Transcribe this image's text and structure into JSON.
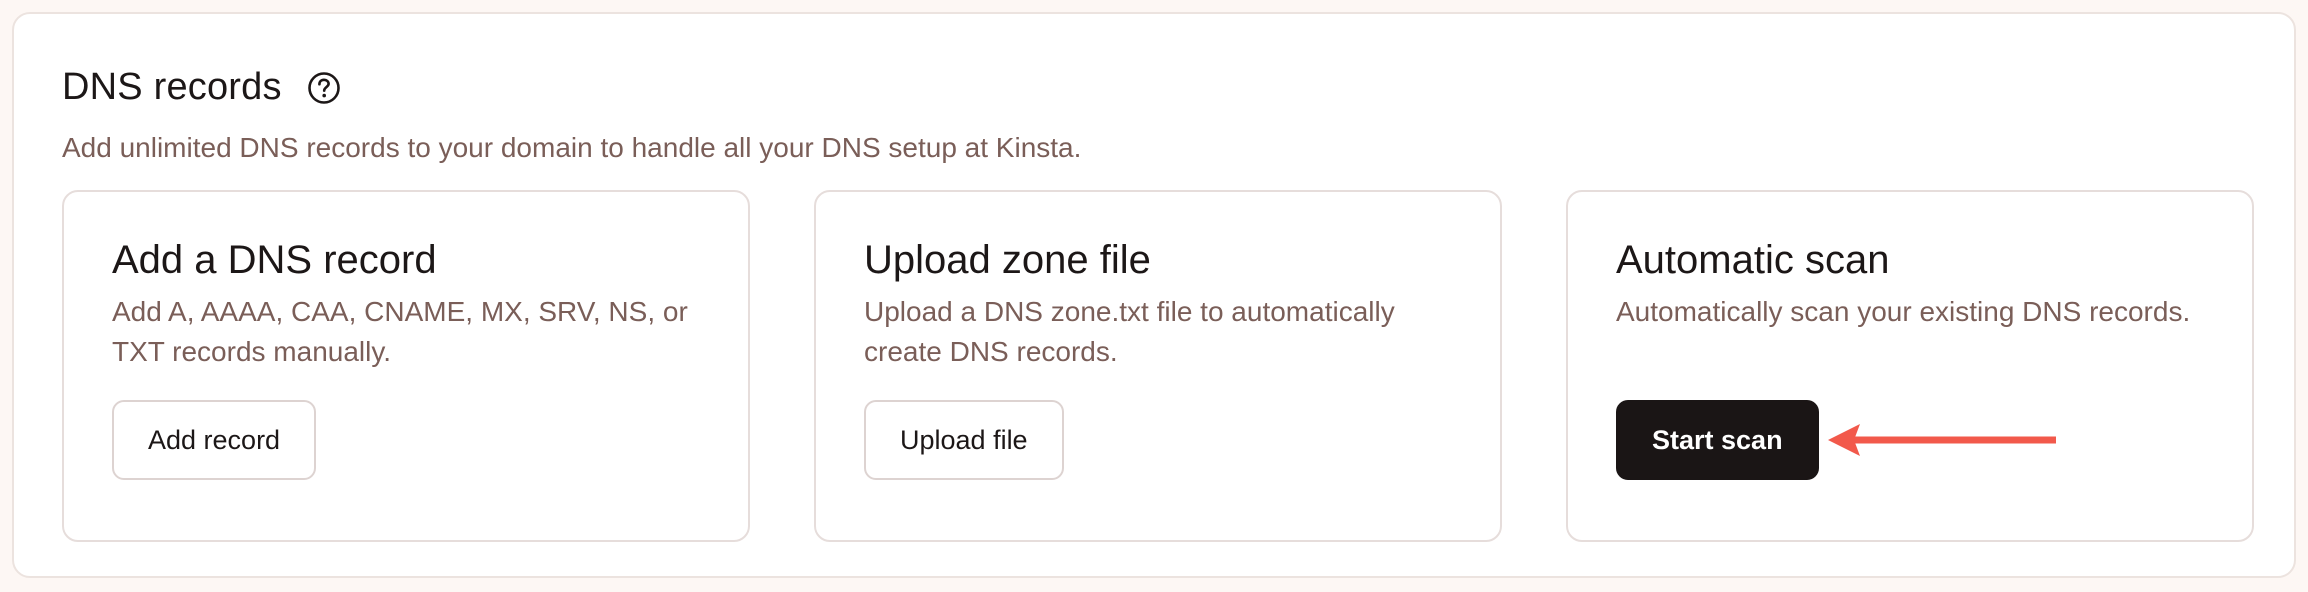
{
  "section": {
    "title": "DNS records",
    "subtitle": "Add unlimited DNS records to your domain to handle all your DNS setup at Kinsta.",
    "help_icon": "question-circle-icon"
  },
  "cards": [
    {
      "title": "Add a DNS record",
      "description": "Add A, AAAA, CAA, CNAME, MX, SRV, NS, or TXT records manually.",
      "button_label": "Add record"
    },
    {
      "title": "Upload zone file",
      "description": "Upload a DNS zone.txt file to automatically create DNS records.",
      "button_label": "Upload file"
    },
    {
      "title": "Automatic scan",
      "description": "Automatically scan your existing DNS records.",
      "button_label": "Start scan"
    }
  ],
  "annotation": {
    "arrow_color": "#f2594b",
    "arrow_icon": "arrow-left-icon"
  },
  "colors": {
    "text_primary": "#1c1717",
    "text_secondary": "#7a5e58",
    "button_dark": "#1a1515",
    "border": "#e6dddb"
  }
}
